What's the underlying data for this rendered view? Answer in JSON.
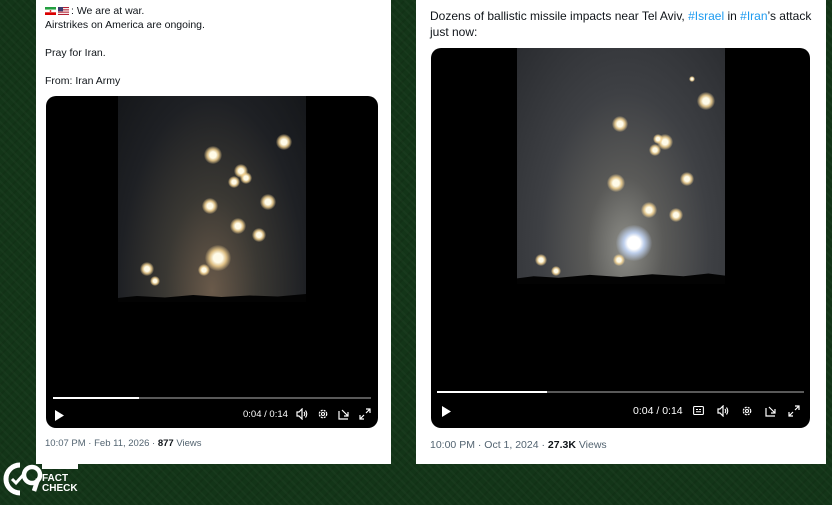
{
  "left_post": {
    "line1": ": We are at war.",
    "line2": "Airstrikes on America are ongoing.",
    "line3": "Pray for Iran.",
    "line4": "From: Iran Army",
    "video": {
      "time": "0:04 / 0:14",
      "progress": 0.27
    },
    "timestamp": "10:07 PM · Feb 11, 2026 · ",
    "views_count": "877",
    "views_label": " Views"
  },
  "right_post": {
    "text_a": "Dozens of ballistic missile impacts near Tel Aviv, ",
    "hashtag1": "#Israel",
    "text_b": " in ",
    "hashtag2": "#Iran",
    "text_c": "’s attack",
    "text_d": "just now:",
    "video": {
      "time": "0:04 / 0:14",
      "progress": 0.3
    },
    "timestamp": "10:00 PM · Oct 1, 2024 · ",
    "views_count": "27.3K",
    "views_label": " Views"
  },
  "logo": {
    "line1": "FACT",
    "line2": "CHECK"
  },
  "colors": {
    "hashtag": "#1d9bf0",
    "background": "#133518"
  }
}
